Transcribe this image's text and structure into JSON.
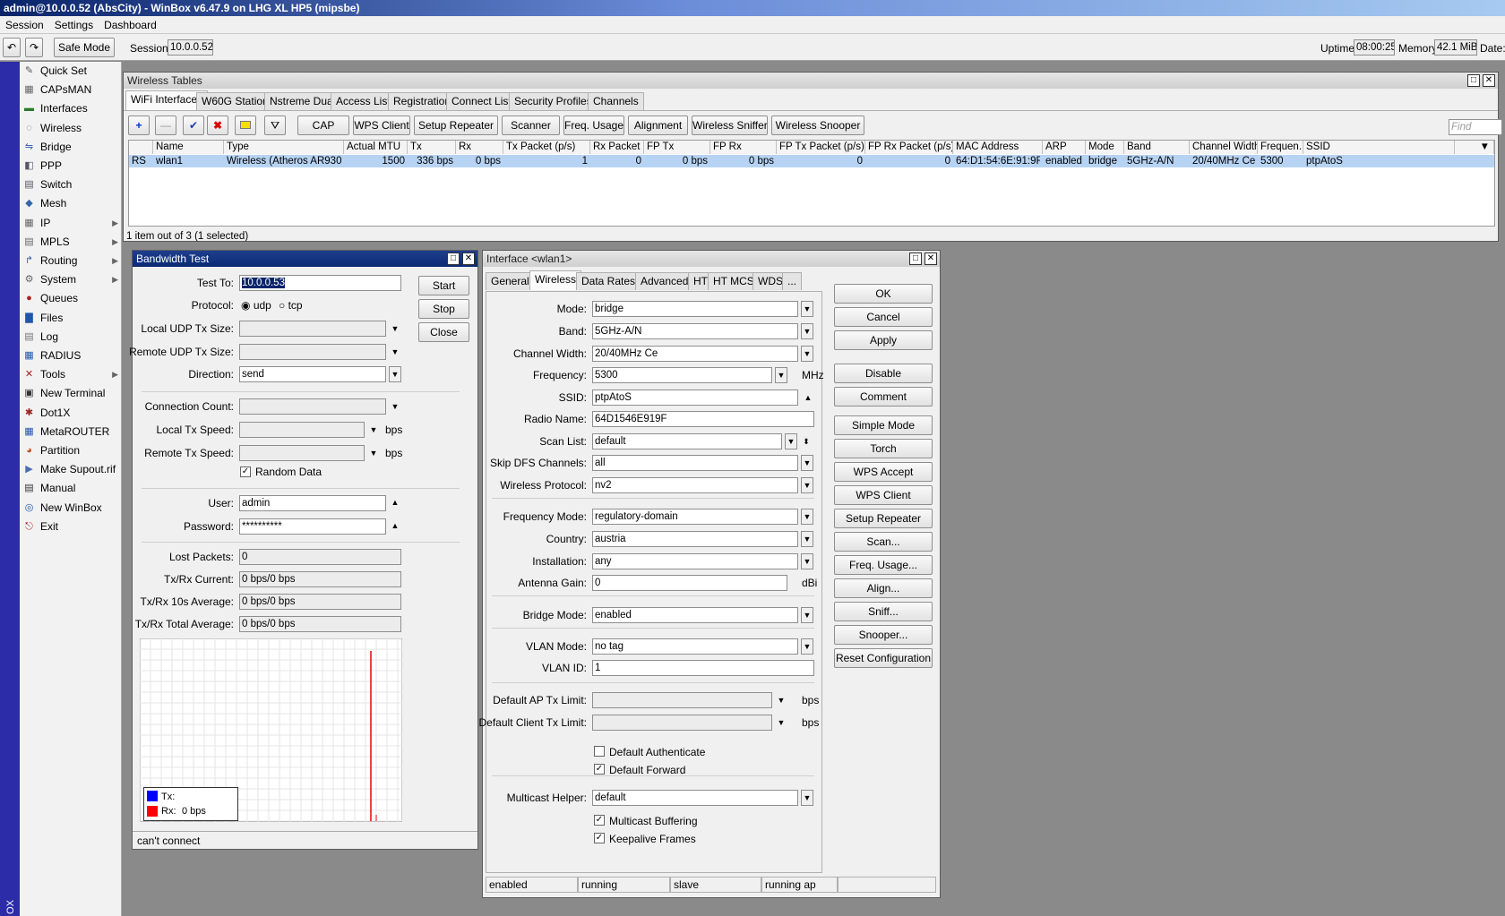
{
  "app": {
    "title": "admin@10.0.0.52 (AbsCity) - WinBox v6.47.9 on LHG XL HP5 (mipsbe)"
  },
  "menu": [
    "Session",
    "Settings",
    "Dashboard"
  ],
  "toolbar": {
    "safe_mode": "Safe Mode",
    "session_label": "Session:",
    "session_value": "10.0.0.52",
    "uptime_label": "Uptime:",
    "uptime_value": "08:00:25",
    "memory_label": "Memory:",
    "memory_value": "42.1 MiB",
    "date_label": "Date:"
  },
  "sidebar": {
    "items": [
      {
        "label": "Quick Set",
        "icon": "wand-icon"
      },
      {
        "label": "CAPsMAN",
        "icon": "capsman-icon"
      },
      {
        "label": "Interfaces",
        "icon": "interfaces-icon"
      },
      {
        "label": "Wireless",
        "icon": "wireless-icon"
      },
      {
        "label": "Bridge",
        "icon": "bridge-icon"
      },
      {
        "label": "PPP",
        "icon": "ppp-icon"
      },
      {
        "label": "Switch",
        "icon": "switch-icon"
      },
      {
        "label": "Mesh",
        "icon": "mesh-icon"
      },
      {
        "label": "IP",
        "icon": "ip-icon"
      },
      {
        "label": "MPLS",
        "icon": "mpls-icon"
      },
      {
        "label": "Routing",
        "icon": "routing-icon"
      },
      {
        "label": "System",
        "icon": "system-icon"
      },
      {
        "label": "Queues",
        "icon": "queues-icon"
      },
      {
        "label": "Files",
        "icon": "files-icon"
      },
      {
        "label": "Log",
        "icon": "log-icon"
      },
      {
        "label": "RADIUS",
        "icon": "radius-icon"
      },
      {
        "label": "Tools",
        "icon": "tools-icon"
      },
      {
        "label": "New Terminal",
        "icon": "terminal-icon"
      },
      {
        "label": "Dot1X",
        "icon": "dot1x-icon"
      },
      {
        "label": "MetaROUTER",
        "icon": "metarouter-icon"
      },
      {
        "label": "Partition",
        "icon": "partition-icon"
      },
      {
        "label": "Make Supout.rif",
        "icon": "supout-icon"
      },
      {
        "label": "Manual",
        "icon": "manual-icon"
      },
      {
        "label": "New WinBox",
        "icon": "winbox-icon"
      },
      {
        "label": "Exit",
        "icon": "exit-icon"
      }
    ],
    "vertical_label": "OX"
  },
  "wireless_tables": {
    "title": "Wireless Tables",
    "tabs": [
      "WiFi Interfaces",
      "W60G Station",
      "Nstreme Dual",
      "Access List",
      "Registration",
      "Connect List",
      "Security Profiles",
      "Channels"
    ],
    "buttons": [
      "CAP",
      "WPS Client",
      "Setup Repeater",
      "Scanner",
      "Freq. Usage",
      "Alignment",
      "Wireless Sniffer",
      "Wireless Snooper"
    ],
    "find_placeholder": "Find",
    "columns": [
      "",
      "Name",
      "Type",
      "Actual MTU",
      "Tx",
      "Rx",
      "Tx Packet (p/s)",
      "Rx Packet (p...",
      "FP Tx",
      "FP Rx",
      "FP Tx Packet (p/s)",
      "FP Rx Packet (p/s)",
      "MAC Address",
      "ARP",
      "Mode",
      "Band",
      "Channel Width",
      "Frequen...",
      "SSID"
    ],
    "row": [
      "RS",
      "wlan1",
      "Wireless (Atheros AR9300)",
      "1500",
      "336 bps",
      "0 bps",
      "1",
      "0",
      "0 bps",
      "0 bps",
      "0",
      "0",
      "64:D1:54:6E:91:9F",
      "enabled",
      "bridge",
      "5GHz-A/N",
      "20/40MHz Ce",
      "5300",
      "ptpAtoS"
    ],
    "status": "1 item out of 3 (1 selected)"
  },
  "bandwidth_test": {
    "title": "Bandwidth Test",
    "test_to_label": "Test To:",
    "test_to_value": "10.0.0.53",
    "protocol_label": "Protocol:",
    "proto_udp": "udp",
    "proto_tcp": "tcp",
    "local_udp_label": "Local UDP Tx Size:",
    "remote_udp_label": "Remote UDP Tx Size:",
    "direction_label": "Direction:",
    "direction_value": "send",
    "conn_count_label": "Connection Count:",
    "local_speed_label": "Local Tx Speed:",
    "remote_speed_label": "Remote Tx Speed:",
    "bps": "bps",
    "random_data": "Random Data",
    "user_label": "User:",
    "user_value": "admin",
    "password_label": "Password:",
    "password_value": "**********",
    "lost_label": "Lost Packets:",
    "lost_value": "0",
    "current_label": "Tx/Rx Current:",
    "current_value": "0 bps/0 bps",
    "avg10_label": "Tx/Rx 10s Average:",
    "avg10_value": "0 bps/0 bps",
    "total_label": "Tx/Rx Total Average:",
    "total_value": "0 bps/0 bps",
    "legend_tx": "Tx:",
    "legend_rx": "Rx:",
    "legend_rx_value": "0 bps",
    "start": "Start",
    "stop": "Stop",
    "close": "Close",
    "status": "can't connect"
  },
  "interface": {
    "title": "Interface <wlan1>",
    "tabs": [
      "General",
      "Wireless",
      "Data Rates",
      "Advanced",
      "HT",
      "HT MCS",
      "WDS",
      "..."
    ],
    "fields": {
      "mode_l": "Mode:",
      "mode_v": "bridge",
      "band_l": "Band:",
      "band_v": "5GHz-A/N",
      "cw_l": "Channel Width:",
      "cw_v": "20/40MHz Ce",
      "freq_l": "Frequency:",
      "freq_v": "5300",
      "mhz": "MHz",
      "ssid_l": "SSID:",
      "ssid_v": "ptpAtoS",
      "radio_l": "Radio Name:",
      "radio_v": "64D1546E919F",
      "scan_l": "Scan List:",
      "scan_v": "default",
      "dfs_l": "Skip DFS Channels:",
      "dfs_v": "all",
      "wp_l": "Wireless Protocol:",
      "wp_v": "nv2",
      "fm_l": "Frequency Mode:",
      "fm_v": "regulatory-domain",
      "country_l": "Country:",
      "country_v": "austria",
      "inst_l": "Installation:",
      "inst_v": "any",
      "ag_l": "Antenna Gain:",
      "ag_v": "0",
      "dbi": "dBi",
      "bm_l": "Bridge Mode:",
      "bm_v": "enabled",
      "vm_l": "VLAN Mode:",
      "vm_v": "no tag",
      "vid_l": "VLAN ID:",
      "vid_v": "1",
      "apl_l": "Default AP Tx Limit:",
      "cl_l": "Default Client Tx Limit:",
      "bps": "bps",
      "def_auth": "Default Authenticate",
      "def_fwd": "Default Forward",
      "mh_l": "Multicast Helper:",
      "mh_v": "default",
      "mc_buf": "Multicast Buffering",
      "ka": "Keepalive Frames"
    },
    "buttons": [
      "OK",
      "Cancel",
      "Apply",
      "Disable",
      "Comment",
      "Simple Mode",
      "Torch",
      "WPS Accept",
      "WPS Client",
      "Setup Repeater",
      "Scan...",
      "Freq. Usage...",
      "Align...",
      "Sniff...",
      "Snooper...",
      "Reset Configuration"
    ],
    "status": [
      "enabled",
      "running",
      "slave",
      "running ap"
    ]
  },
  "graph": {
    "rx_spike": 1.0
  }
}
